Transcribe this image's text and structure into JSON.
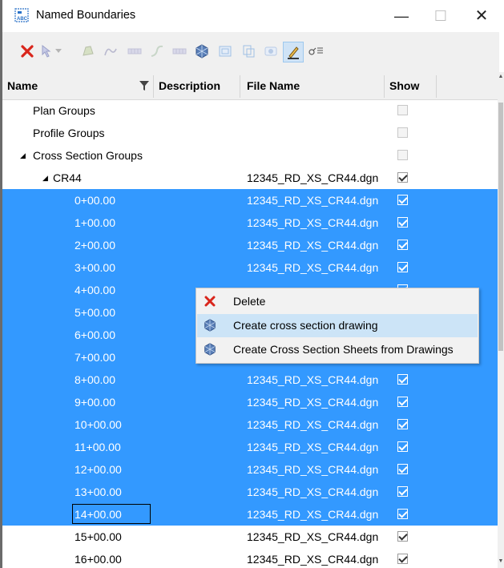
{
  "window": {
    "title": "Named Boundaries",
    "app_icon": "named-boundaries-icon",
    "controls": {
      "minimize": "—",
      "maximize": "☐",
      "close": "✕"
    }
  },
  "toolbar": {
    "icons": [
      "delete-icon",
      "select-boundary-icon",
      "dropdown-arrow-icon",
      "boundary-icon",
      "profile-icon",
      "grid-icon",
      "alignment-icon",
      "grid2-icon",
      "create-drawing-icon",
      "frame-icon",
      "sheet-icon",
      "boundary-display-icon",
      "edit-pen-icon",
      "filter-settings-icon"
    ]
  },
  "columns": {
    "name": "Name",
    "description": "Description",
    "file_name": "File Name",
    "show": "Show"
  },
  "rows": [
    {
      "name": "Plan Groups",
      "file": "",
      "show": false,
      "selected": false,
      "level": 1,
      "expander": ""
    },
    {
      "name": "Profile Groups",
      "file": "",
      "show": false,
      "selected": false,
      "level": 1,
      "expander": ""
    },
    {
      "name": "Cross Section Groups",
      "file": "",
      "show": false,
      "selected": false,
      "level": 1,
      "expander": "◢"
    },
    {
      "name": "CR44",
      "file": "12345_RD_XS_CR44.dgn",
      "show": true,
      "selected": false,
      "level": 2,
      "expander": "◢"
    },
    {
      "name": "0+00.00",
      "file": "12345_RD_XS_CR44.dgn",
      "show": true,
      "selected": true,
      "level": 3,
      "expander": ""
    },
    {
      "name": "1+00.00",
      "file": "12345_RD_XS_CR44.dgn",
      "show": true,
      "selected": true,
      "level": 3,
      "expander": ""
    },
    {
      "name": "2+00.00",
      "file": "12345_RD_XS_CR44.dgn",
      "show": true,
      "selected": true,
      "level": 3,
      "expander": ""
    },
    {
      "name": "3+00.00",
      "file": "12345_RD_XS_CR44.dgn",
      "show": true,
      "selected": true,
      "level": 3,
      "expander": ""
    },
    {
      "name": "4+00.00",
      "file": "",
      "show": true,
      "selected": true,
      "level": 3,
      "expander": ""
    },
    {
      "name": "5+00.00",
      "file": "",
      "show": true,
      "selected": true,
      "level": 3,
      "expander": ""
    },
    {
      "name": "6+00.00",
      "file": "",
      "show": true,
      "selected": true,
      "level": 3,
      "expander": ""
    },
    {
      "name": "7+00.00",
      "file": "",
      "show": true,
      "selected": true,
      "level": 3,
      "expander": ""
    },
    {
      "name": "8+00.00",
      "file": "12345_RD_XS_CR44.dgn",
      "show": true,
      "selected": true,
      "level": 3,
      "expander": ""
    },
    {
      "name": "9+00.00",
      "file": "12345_RD_XS_CR44.dgn",
      "show": true,
      "selected": true,
      "level": 3,
      "expander": ""
    },
    {
      "name": "10+00.00",
      "file": "12345_RD_XS_CR44.dgn",
      "show": true,
      "selected": true,
      "level": 3,
      "expander": ""
    },
    {
      "name": "11+00.00",
      "file": "12345_RD_XS_CR44.dgn",
      "show": true,
      "selected": true,
      "level": 3,
      "expander": ""
    },
    {
      "name": "12+00.00",
      "file": "12345_RD_XS_CR44.dgn",
      "show": true,
      "selected": true,
      "level": 3,
      "expander": ""
    },
    {
      "name": "13+00.00",
      "file": "12345_RD_XS_CR44.dgn",
      "show": true,
      "selected": true,
      "level": 3,
      "expander": ""
    },
    {
      "name": "14+00.00",
      "file": "12345_RD_XS_CR44.dgn",
      "show": true,
      "selected": true,
      "level": 3,
      "expander": "",
      "focused": true
    },
    {
      "name": "15+00.00",
      "file": "12345_RD_XS_CR44.dgn",
      "show": true,
      "selected": false,
      "level": 3,
      "expander": ""
    },
    {
      "name": "16+00.00",
      "file": "12345_RD_XS_CR44.dgn",
      "show": true,
      "selected": false,
      "level": 3,
      "expander": ""
    }
  ],
  "context_menu": {
    "items": [
      {
        "label": "Delete",
        "icon": "delete-icon",
        "hover": false
      },
      {
        "label": "Create cross section drawing",
        "icon": "create-drawing-icon",
        "hover": true
      },
      {
        "label": "Create Cross Section Sheets from Drawings",
        "icon": "create-sheets-icon",
        "hover": false
      }
    ]
  },
  "colors": {
    "selection": "#3399ff",
    "menu_hover": "#cce4f7",
    "delete_red": "#d9261c"
  }
}
